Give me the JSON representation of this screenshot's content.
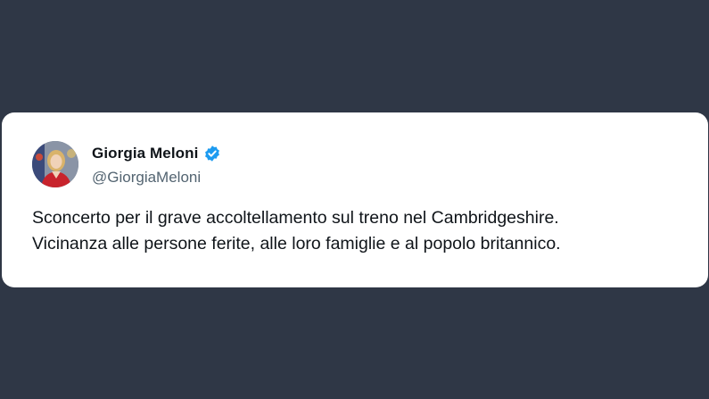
{
  "tweet": {
    "author": {
      "display_name": "Giorgia Meloni",
      "handle": "@GiorgiaMeloni",
      "verified": true,
      "avatar_icon": "profile-photo-icon"
    },
    "text_lines": [
      "Sconcerto per il grave accoltellamento sul treno nel Cambridgeshire.",
      "Vicinanza alle persone ferite, alle loro famiglie e al popolo britannico."
    ]
  },
  "colors": {
    "background": "#2f3746",
    "card": "#ffffff",
    "verified_badge": "#1d9bf0",
    "handle": "#536471",
    "text": "#0f1419"
  }
}
